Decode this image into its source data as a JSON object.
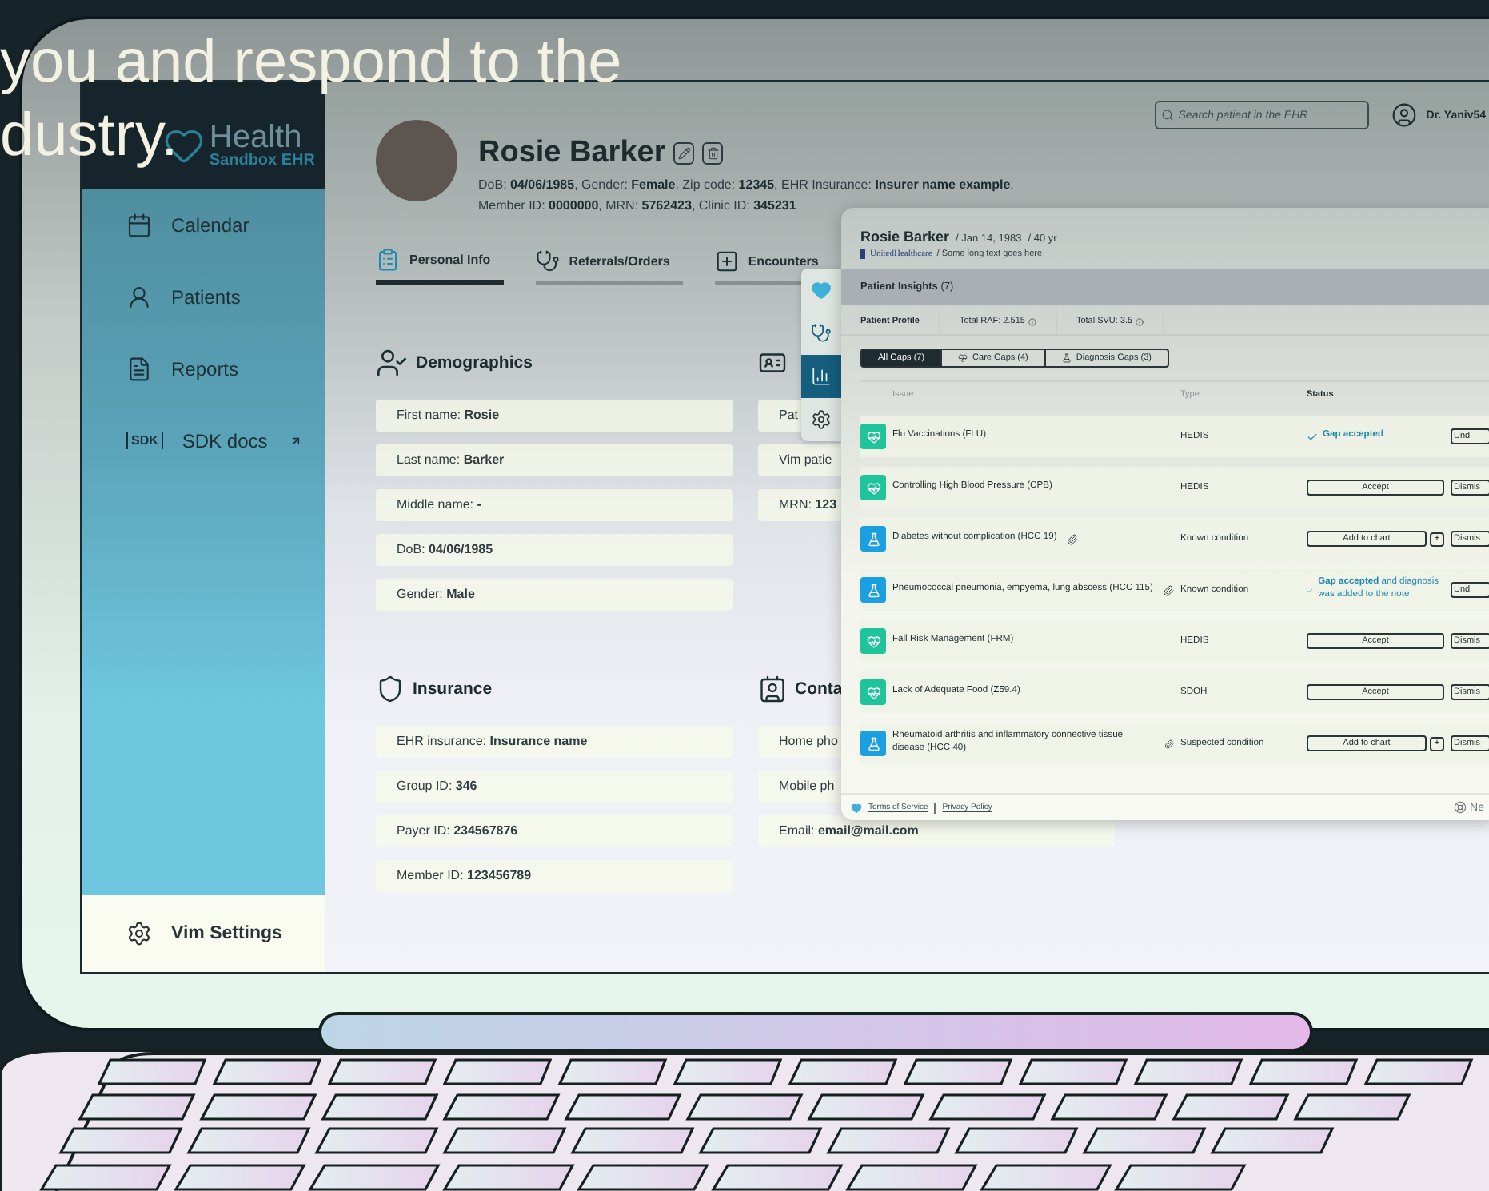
{
  "headline": {
    "lines": [
      "you and respond to the",
      "dustry."
    ]
  },
  "logo": {
    "title": "Health",
    "subtitle": "Sandbox EHR"
  },
  "sidebar": {
    "items": [
      {
        "label": "Calendar",
        "kind": "calendar",
        "external": false
      },
      {
        "label": "Patients",
        "kind": "patients",
        "external": false
      },
      {
        "label": "Reports",
        "kind": "reports",
        "external": false
      },
      {
        "label": "SDK docs",
        "kind": "text",
        "icon_label": "SDK",
        "external": true
      }
    ],
    "settings": "Vim Settings"
  },
  "header": {
    "search": {
      "placeholder": "Search patient in the EHR"
    },
    "user": "Dr. Yaniv54"
  },
  "patient": {
    "name": "Rosie Barker",
    "details": [
      "DoB: **04/06/1985**, Gender: **Female**, Zip code: **12345**, EHR Insurance: **Insurer name example**,",
      "Member ID: **0000000**, MRN: **5762423**, Clinic ID: **345231**"
    ]
  },
  "tabs": [
    {
      "label": "Personal Info",
      "kind": "clipboard",
      "selected": true
    },
    {
      "label": "Referrals/Orders",
      "kind": "stethoscope",
      "selected": false
    },
    {
      "label": "Encounters",
      "kind": "encounter",
      "selected": false
    }
  ],
  "sections": [
    {
      "title": "Demographics",
      "kind": "person",
      "fields": [
        "First name: **Rosie**",
        "Last name: **Barker**",
        "Middle name: **-**",
        "DoB: **04/06/1985**",
        "Gender: **Male**"
      ]
    },
    {
      "kind": "idcard",
      "fields": [
        "Pat",
        "Vim patie",
        "MRN: **123**"
      ]
    },
    {
      "title": "Insurance",
      "kind": "shield",
      "fields": [
        "EHR insurance: **Insurance name**",
        "Group ID: **346**",
        "Payer ID: **234567876**",
        "Member ID: **123456789**"
      ]
    },
    {
      "title": "Conta",
      "kind": "contact",
      "fields": [
        "Home pho",
        "Mobile ph",
        "Email: **email@mail.com**"
      ]
    }
  ],
  "toolbar": [
    {
      "kind": "heart",
      "selected": false
    },
    {
      "kind": "stethoscope",
      "selected": false
    },
    {
      "kind": "chart",
      "selected": true
    },
    {
      "kind": "gear",
      "selected": false
    }
  ],
  "insights": {
    "name": "Rosie Barker",
    "dob": "/ Jan 14, 1983",
    "age": "/ 40 yr",
    "insurer": "UnitedHealthcare",
    "note": "/ Some long text goes here",
    "title": "Patient Insights",
    "count": "(7)",
    "profile": [
      "Patient Profile",
      "Total RAF: 2.515",
      "Total SVU: 3.5"
    ],
    "filters": [
      {
        "label": "All Gaps (7)",
        "kind": "all",
        "selected": true
      },
      {
        "label": "Care Gaps (4)",
        "kind": "care",
        "selected": false
      },
      {
        "label": "Diagnosis Gaps (3)",
        "kind": "diagnosis",
        "selected": false
      }
    ],
    "columns": [
      "Issue",
      "Type",
      "Status"
    ],
    "rows": [
      {
        "kind": "care",
        "issue": "Flu Vaccinations (FLU)",
        "type": "HEDIS",
        "status": {
          "kind": "accepted",
          "text": "Gap accepted"
        },
        "action": "Und"
      },
      {
        "kind": "care",
        "issue": "Controlling High Blood Pressure (CPB)",
        "type": "HEDIS",
        "status": {
          "kind": "accept",
          "text": "Accept"
        },
        "action": "Dismis"
      },
      {
        "kind": "diagnosis",
        "issue": "Diabetes without complication (HCC 19)",
        "type": "Known condition",
        "status": {
          "kind": "add",
          "text": "Add to chart",
          "plus": "+"
        },
        "action": "Dismis"
      },
      {
        "kind": "diagnosis",
        "issue": "Pneumococcal pneumonia, empyema, lung abscess (HCC 115)",
        "type": "Known condition",
        "status": {
          "kind": "accepted",
          "text": "Gap accepted",
          "note": "and diagnosis was added to the note"
        },
        "action": "Und"
      },
      {
        "kind": "care",
        "issue": "Fall Risk Management (FRM)",
        "type": "HEDIS",
        "status": {
          "kind": "accept",
          "text": "Accept"
        },
        "action": "Dismis"
      },
      {
        "kind": "care",
        "issue": "Lack of Adequate Food (Z59.4)",
        "type": "SDOH",
        "status": {
          "kind": "accept",
          "text": "Accept"
        },
        "action": "Dismis"
      },
      {
        "kind": "diagnosis",
        "issue": "Rheumatoid arthritis and inflammatory connective tissue disease (HCC 40)",
        "type": "Suspected condition",
        "status": {
          "kind": "add",
          "text": "Add to chart",
          "plus": "+"
        },
        "action": "Dismis"
      }
    ],
    "footer": {
      "links": [
        "Terms of Service",
        "Privacy Policy"
      ],
      "right": "Ne"
    }
  }
}
